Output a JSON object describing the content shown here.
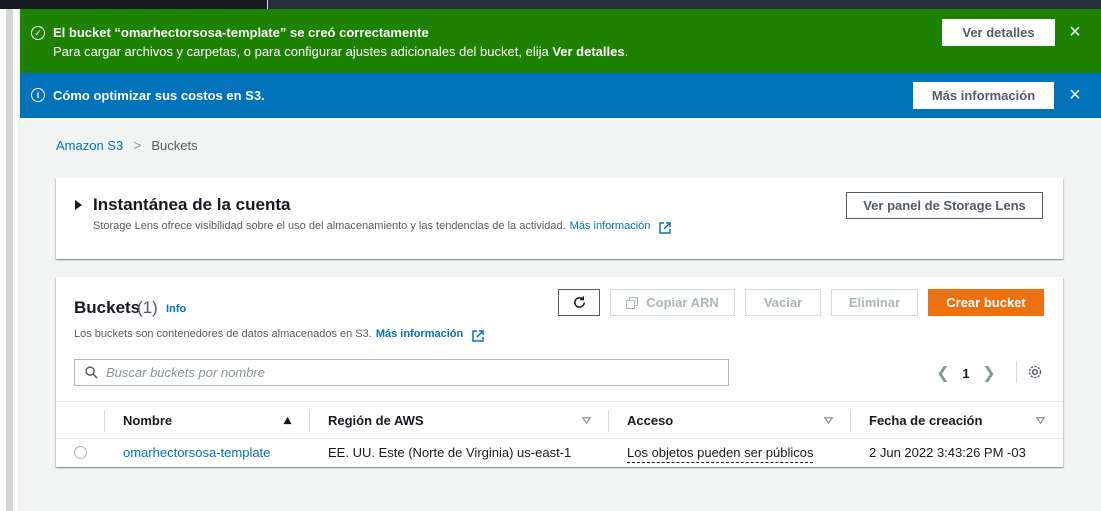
{
  "flash_success": {
    "title": "El bucket “omarhectorsosa-template” se creó correctamente",
    "desc_prefix": "Para cargar archivos y carpetas, o para configurar ajustes adicionales del bucket, elija ",
    "desc_link": "Ver detalles",
    "desc_suffix": ".",
    "button": "Ver detalles",
    "icon": "check-circle-icon",
    "color": "#1d8102"
  },
  "flash_info": {
    "title": "Cómo optimizar sus costos en S3.",
    "button": "Más información",
    "icon": "info-circle-icon",
    "color": "#0073bb"
  },
  "breadcrumb": {
    "root": "Amazon S3",
    "current": "Buckets"
  },
  "snapshot": {
    "title": "Instantánea de la cuenta",
    "description": "Storage Lens ofrece visibilidad sobre el uso del almacenamiento y las tendencias de la actividad.",
    "link": "Más información",
    "button": "Ver panel de Storage Lens"
  },
  "buckets": {
    "title": "Buckets",
    "count": "(1)",
    "info": "Info",
    "description": "Los buckets son contenedores de datos almacenados en S3.",
    "link": "Más información",
    "actions": {
      "copy_arn": "Copiar ARN",
      "empty": "Vaciar",
      "delete": "Eliminar",
      "create": "Crear bucket"
    },
    "search_placeholder": "Buscar buckets por nombre",
    "page": "1",
    "columns": {
      "name": "Nombre",
      "region": "Región de AWS",
      "access": "Acceso",
      "created": "Fecha de creación"
    },
    "rows": [
      {
        "name": "omarhectorsosa-template",
        "region": "EE. UU. Este (Norte de Virginia) us-east-1",
        "access": "Los objetos pueden ser públicos",
        "created": "2 Jun 2022 3:43:26 PM -03"
      }
    ]
  },
  "colors": {
    "primary": "#ec7211",
    "link": "#0073bb",
    "success": "#1d8102",
    "info": "#0073bb"
  }
}
